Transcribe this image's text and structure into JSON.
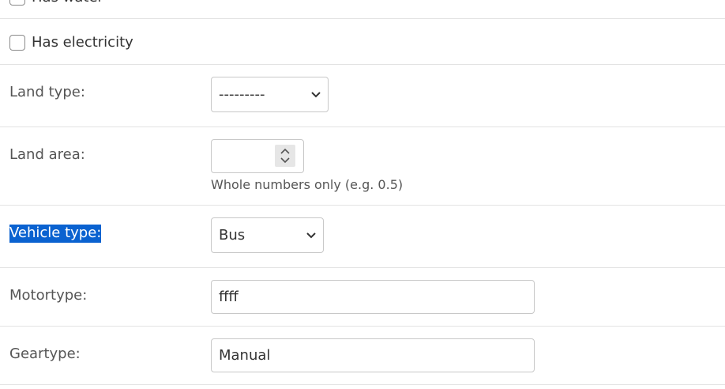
{
  "form": {
    "has_water_label": "Has water",
    "has_electricity_label": "Has electricity",
    "land_type": {
      "label": "Land type:",
      "selected": "---------"
    },
    "land_area": {
      "label": "Land area:",
      "value": "",
      "help": "Whole numbers only (e.g. 0.5)"
    },
    "vehicle_type": {
      "label": "Vehicle type:",
      "selected": "Bus"
    },
    "motortype": {
      "label": "Motortype:",
      "value": "ffff"
    },
    "geartype": {
      "label": "Geartype:",
      "value": "Manual"
    }
  },
  "colors": {
    "selection_highlight": "#0a62d0",
    "divider": "#e3e3e3",
    "input_border": "#c8c8c8"
  }
}
